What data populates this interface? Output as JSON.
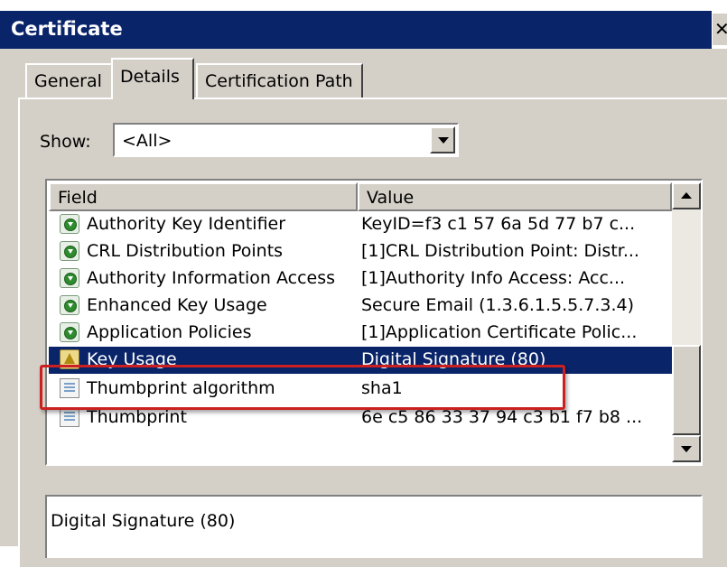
{
  "window": {
    "title": "Certificate",
    "close_glyph": "✕"
  },
  "tabs": [
    {
      "label": "General",
      "active": false
    },
    {
      "label": "Details",
      "active": true
    },
    {
      "label": "Certification Path",
      "active": false
    }
  ],
  "show": {
    "label": "Show:",
    "value": "<All>"
  },
  "list": {
    "columns": {
      "field": "Field",
      "value": "Value"
    },
    "rows": [
      {
        "icon": "green-cert-extension-icon",
        "field": "Authority Key Identifier",
        "value": "KeyID=f3 c1 57 6a 5d 77 b7 c..."
      },
      {
        "icon": "green-cert-extension-icon",
        "field": "CRL Distribution Points",
        "value": "[1]CRL Distribution Point: Distr..."
      },
      {
        "icon": "green-cert-extension-icon",
        "field": "Authority Information Access",
        "value": "[1]Authority Info Access: Acc..."
      },
      {
        "icon": "green-cert-extension-icon",
        "field": "Enhanced Key Usage",
        "value": "Secure Email (1.3.6.1.5.5.7.3.4)"
      },
      {
        "icon": "green-cert-extension-icon",
        "field": "Application Policies",
        "value": "[1]Application Certificate Polic..."
      },
      {
        "icon": "warning-cert-extension-icon",
        "field": "Key Usage",
        "value": "Digital Signature (80)",
        "selected": true
      },
      {
        "icon": "document-property-icon",
        "field": "Thumbprint algorithm",
        "value": "sha1"
      },
      {
        "icon": "document-property-icon",
        "field": "Thumbprint",
        "value": "6e c5 86 33 37 94 c3 b1 f7 b8 ..."
      }
    ]
  },
  "details_text": "Digital Signature (80)",
  "colors": {
    "selection": "#0a246a",
    "highlight_box": "#cc2020",
    "dialog_face": "#d4d0c8"
  }
}
